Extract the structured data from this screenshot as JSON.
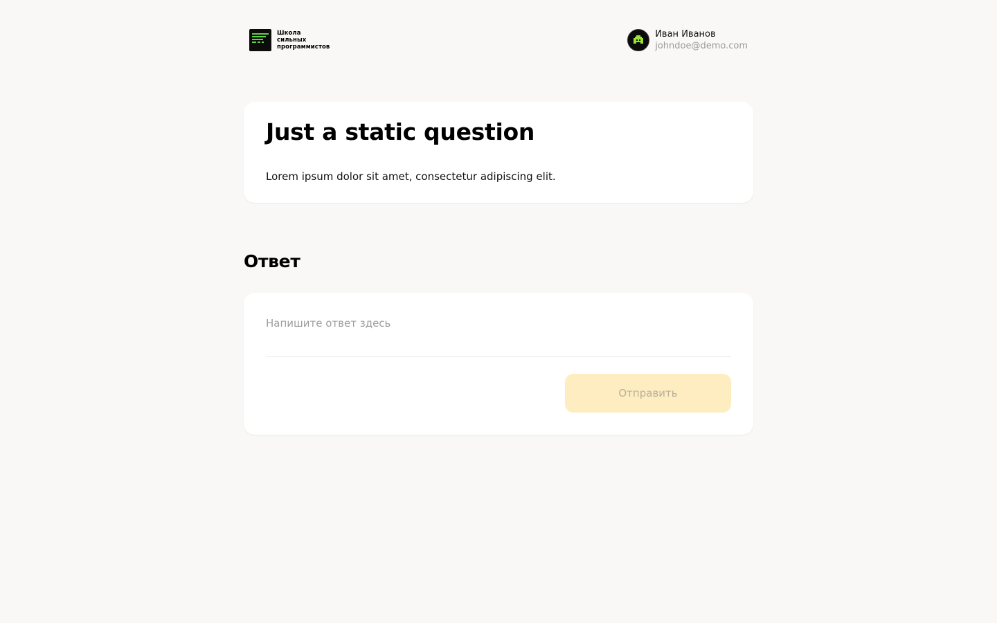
{
  "header": {
    "logo": {
      "icon": "code-lines-icon",
      "line1": "Школа",
      "line2": "сильных",
      "line3": "программистов",
      "accent": "#5fd24a"
    },
    "user": {
      "avatar_icon": "pixel-avatar-icon",
      "name": "Иван Иванов",
      "email": "johndoe@demo.com"
    }
  },
  "question": {
    "title": "Just a static question",
    "text": "Lorem ipsum dolor sit amet, consectetur adipiscing elit."
  },
  "answer": {
    "heading": "Ответ",
    "input_value": "",
    "input_placeholder": "Напишите ответ здесь",
    "submit_label": "Отправить",
    "submit_bg": "#feedc0",
    "submit_disabled": true
  },
  "colors": {
    "background": "#f9f8f6",
    "card": "#ffffff"
  }
}
